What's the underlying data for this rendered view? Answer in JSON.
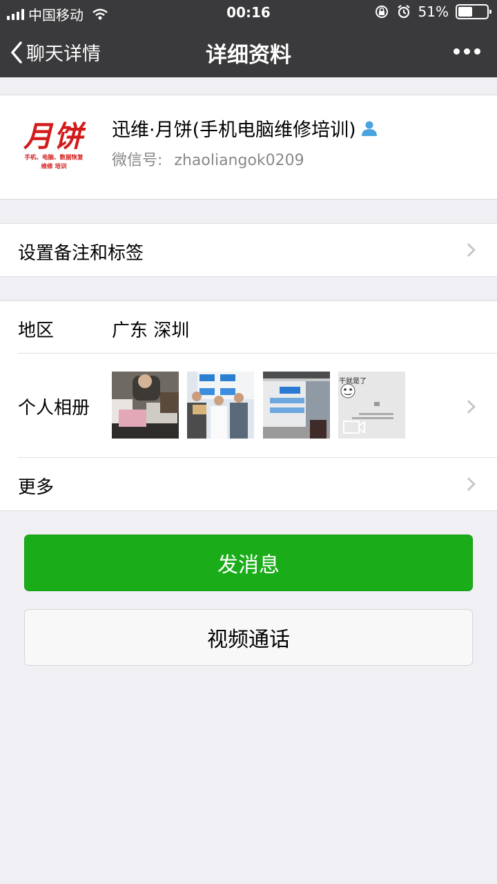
{
  "status_bar": {
    "carrier": "中国移动",
    "time": "00:16",
    "battery_percent": "51%",
    "battery_level": 0.51
  },
  "nav": {
    "back_label": "聊天详情",
    "title": "详细资料"
  },
  "profile": {
    "name": "迅维·月饼(手机电脑维修培训)",
    "wechat_id_label": "微信号:",
    "wechat_id": "zhaoliangok0209",
    "logo_main": "月饼",
    "logo_line1": "手机、电脑、数据恢复",
    "logo_line2": "维修 培训"
  },
  "rows": {
    "remark": "设置备注和标签",
    "region_label": "地区",
    "region_value": "广东 深圳",
    "album_label": "个人相册",
    "more_label": "更多"
  },
  "album": {
    "thumb4_text": "干就是了"
  },
  "buttons": {
    "send_message": "发消息",
    "video_call": "视频通话"
  },
  "colors": {
    "nav_bg": "#3a3a3c",
    "accent_green": "#1aad19",
    "logo_red": "#d21b1b"
  }
}
